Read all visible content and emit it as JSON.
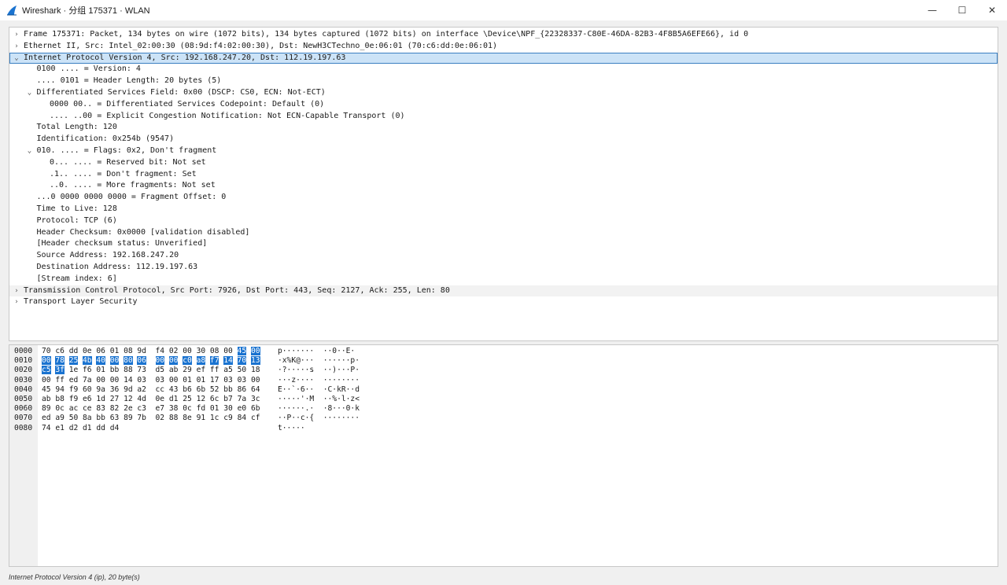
{
  "window": {
    "title": "Wireshark · 分组 175371 · WLAN",
    "minimize_glyph": "—",
    "maximize_glyph": "☐",
    "close_glyph": "✕",
    "icon": "wireshark-fin-icon",
    "accent": "#1a73d0"
  },
  "tree": {
    "rows": [
      {
        "indent": 0,
        "expander": "›",
        "text": "Frame 175371: Packet, 134 bytes on wire (1072 bits), 134 bytes captured (1072 bits) on interface \\Device\\NPF_{22328337-C80E-46DA-82B3-4F8B5A6EFE66}, id 0"
      },
      {
        "indent": 0,
        "expander": "›",
        "text": "Ethernet II, Src: Intel_02:00:30 (08:9d:f4:02:00:30), Dst: NewH3CTechno_0e:06:01 (70:c6:dd:0e:06:01)"
      },
      {
        "indent": 0,
        "expander": "⌄",
        "text": "Internet Protocol Version 4, Src: 192.168.247.20, Dst: 112.19.197.63",
        "selected": true
      },
      {
        "indent": 1,
        "expander": "",
        "text": "0100 .... = Version: 4"
      },
      {
        "indent": 1,
        "expander": "",
        "text": ".... 0101 = Header Length: 20 bytes (5)"
      },
      {
        "indent": 1,
        "expander": "⌄",
        "text": "Differentiated Services Field: 0x00 (DSCP: CS0, ECN: Not-ECT)"
      },
      {
        "indent": 2,
        "expander": "",
        "text": "0000 00.. = Differentiated Services Codepoint: Default (0)"
      },
      {
        "indent": 2,
        "expander": "",
        "text": ".... ..00 = Explicit Congestion Notification: Not ECN-Capable Transport (0)"
      },
      {
        "indent": 1,
        "expander": "",
        "text": "Total Length: 120"
      },
      {
        "indent": 1,
        "expander": "",
        "text": "Identification: 0x254b (9547)"
      },
      {
        "indent": 1,
        "expander": "⌄",
        "text": "010. .... = Flags: 0x2, Don't fragment"
      },
      {
        "indent": 2,
        "expander": "",
        "text": "0... .... = Reserved bit: Not set"
      },
      {
        "indent": 2,
        "expander": "",
        "text": ".1.. .... = Don't fragment: Set"
      },
      {
        "indent": 2,
        "expander": "",
        "text": "..0. .... = More fragments: Not set"
      },
      {
        "indent": 1,
        "expander": "",
        "text": "...0 0000 0000 0000 = Fragment Offset: 0"
      },
      {
        "indent": 1,
        "expander": "",
        "text": "Time to Live: 128"
      },
      {
        "indent": 1,
        "expander": "",
        "text": "Protocol: TCP (6)"
      },
      {
        "indent": 1,
        "expander": "",
        "text": "Header Checksum: 0x0000 [validation disabled]"
      },
      {
        "indent": 1,
        "expander": "",
        "text": "[Header checksum status: Unverified]"
      },
      {
        "indent": 1,
        "expander": "",
        "text": "Source Address: 192.168.247.20"
      },
      {
        "indent": 1,
        "expander": "",
        "text": "Destination Address: 112.19.197.63"
      },
      {
        "indent": 1,
        "expander": "",
        "text": "[Stream index: 6]"
      },
      {
        "indent": 0,
        "expander": "›",
        "text": "Transmission Control Protocol, Src Port: 7926, Dst Port: 443, Seq: 2127, Ack: 255, Len: 80",
        "alt": true
      },
      {
        "indent": 0,
        "expander": "›",
        "text": "Transport Layer Security"
      }
    ]
  },
  "hex": {
    "rows": [
      {
        "offset": "0000",
        "bytes": [
          "70",
          "c6",
          "dd",
          "0e",
          "06",
          "01",
          "08",
          "9d",
          "f4",
          "02",
          "00",
          "30",
          "08",
          "00",
          "45",
          "00"
        ],
        "ascii": "p·······  ··0··E·",
        "hl_from": 14,
        "hl_to": 16
      },
      {
        "offset": "0010",
        "bytes": [
          "00",
          "78",
          "25",
          "4b",
          "40",
          "00",
          "80",
          "06",
          "00",
          "00",
          "c0",
          "a8",
          "f7",
          "14",
          "70",
          "13"
        ],
        "ascii": "·x%K@···  ······p·",
        "hl_from": 0,
        "hl_to": 16
      },
      {
        "offset": "0020",
        "bytes": [
          "c5",
          "3f",
          "1e",
          "f6",
          "01",
          "bb",
          "88",
          "73",
          "d5",
          "ab",
          "29",
          "ef",
          "ff",
          "a5",
          "50",
          "18"
        ],
        "ascii": "·?·····s  ··)···P·",
        "hl_from": 0,
        "hl_to": 2
      },
      {
        "offset": "0030",
        "bytes": [
          "00",
          "ff",
          "ed",
          "7a",
          "00",
          "00",
          "14",
          "03",
          "03",
          "00",
          "01",
          "01",
          "17",
          "03",
          "03",
          "00"
        ],
        "ascii": "···z····  ········",
        "hl_from": 0,
        "hl_to": 0
      },
      {
        "offset": "0040",
        "bytes": [
          "45",
          "94",
          "f9",
          "60",
          "9a",
          "36",
          "9d",
          "a2",
          "cc",
          "43",
          "b6",
          "6b",
          "52",
          "bb",
          "86",
          "64"
        ],
        "ascii": "E··`·6··  ·C·kR··d",
        "hl_from": 0,
        "hl_to": 0
      },
      {
        "offset": "0050",
        "bytes": [
          "ab",
          "b8",
          "f9",
          "e6",
          "1d",
          "27",
          "12",
          "4d",
          "0e",
          "d1",
          "25",
          "12",
          "6c",
          "b7",
          "7a",
          "3c"
        ],
        "ascii": "·····'·M  ··%·l·z<",
        "hl_from": 0,
        "hl_to": 0
      },
      {
        "offset": "0060",
        "bytes": [
          "89",
          "0c",
          "ac",
          "ce",
          "83",
          "82",
          "2e",
          "c3",
          "e7",
          "38",
          "0c",
          "fd",
          "01",
          "30",
          "e0",
          "6b"
        ],
        "ascii": "······.·  ·8···0·k",
        "hl_from": 0,
        "hl_to": 0
      },
      {
        "offset": "0070",
        "bytes": [
          "ed",
          "a9",
          "50",
          "8a",
          "bb",
          "63",
          "89",
          "7b",
          "02",
          "88",
          "8e",
          "91",
          "1c",
          "c9",
          "84",
          "cf"
        ],
        "ascii": "··P··c·{  ········",
        "hl_from": 0,
        "hl_to": 0
      },
      {
        "offset": "0080",
        "bytes": [
          "74",
          "e1",
          "d2",
          "d1",
          "dd",
          "d4"
        ],
        "ascii": "t·····",
        "hl_from": 0,
        "hl_to": 0
      }
    ]
  },
  "status": {
    "text": "Internet Protocol Version 4 (ip), 20 byte(s)"
  }
}
